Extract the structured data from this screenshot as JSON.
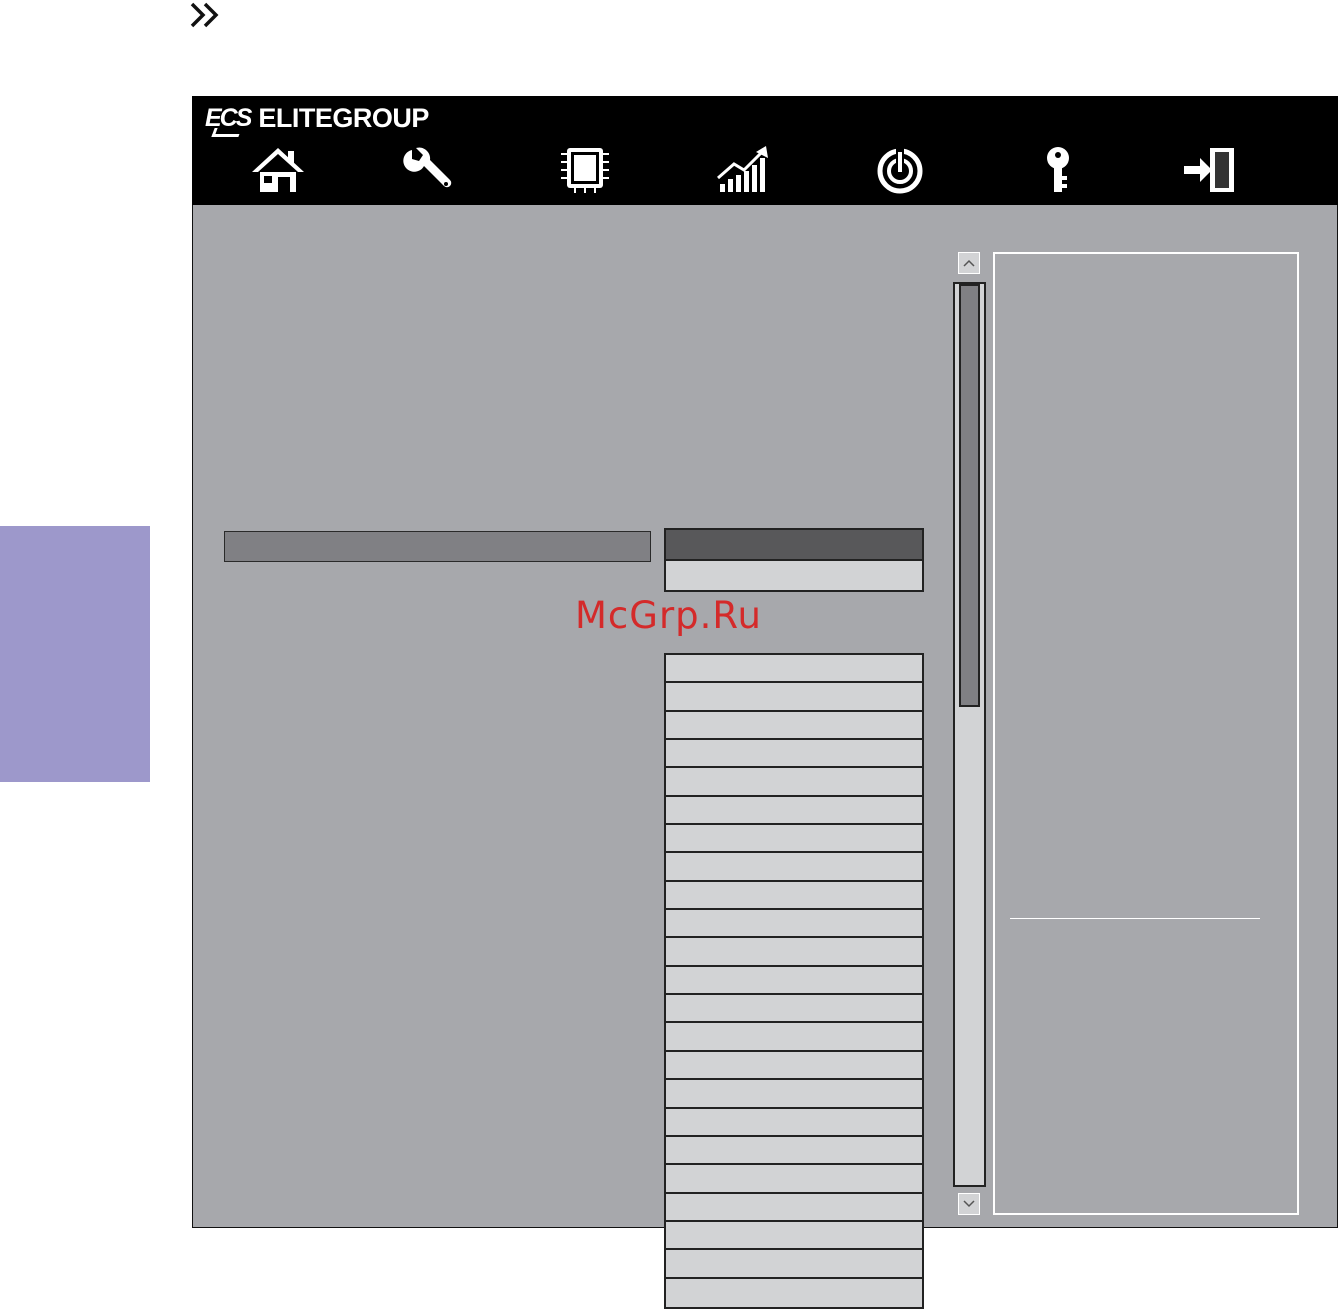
{
  "header": {
    "brand_mark": "ECS",
    "brand_name": "ELITEGROUP"
  },
  "nav": {
    "items": [
      {
        "icon": "home-icon"
      },
      {
        "icon": "wrench-icon"
      },
      {
        "icon": "chip-icon"
      },
      {
        "icon": "chart-icon"
      },
      {
        "icon": "power-icon"
      },
      {
        "icon": "key-icon"
      },
      {
        "icon": "exit-icon"
      }
    ]
  },
  "scrollbar": {
    "position": 0
  },
  "watermark": "McGrp.Ru",
  "colors": {
    "header_bg": "#000000",
    "content_bg": "#a7a8ac",
    "side_tab": "#9d98cb",
    "selected_value": "#58585a",
    "light_value": "#d2d3d5"
  }
}
